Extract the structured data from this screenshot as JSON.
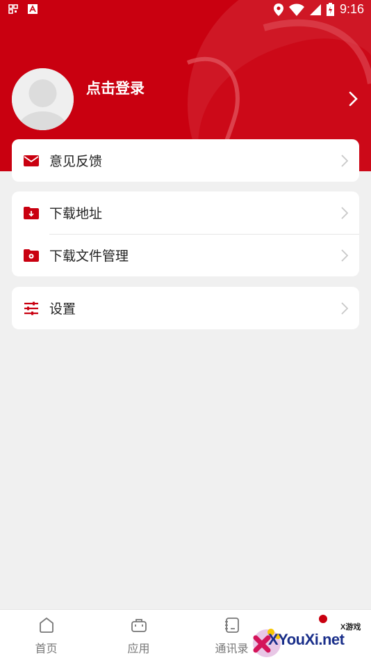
{
  "status_bar": {
    "time": "9:16",
    "battery_glyph": "⚡"
  },
  "profile": {
    "login_text": "点击登录"
  },
  "menu": {
    "feedback": "意见反馈",
    "download_address": "下载地址",
    "download_file_manager": "下载文件管理",
    "settings": "设置"
  },
  "tabs": [
    {
      "label": "首页",
      "icon": "home-icon"
    },
    {
      "label": "应用",
      "icon": "briefcase-icon"
    },
    {
      "label": "通讯录",
      "icon": "contacts-icon"
    }
  ],
  "watermark": {
    "brand": "XYouXi.net",
    "tag": "X游戏"
  },
  "colors": {
    "brand_red": "#c90010",
    "background": "#f0f0f0",
    "card": "#ffffff"
  }
}
